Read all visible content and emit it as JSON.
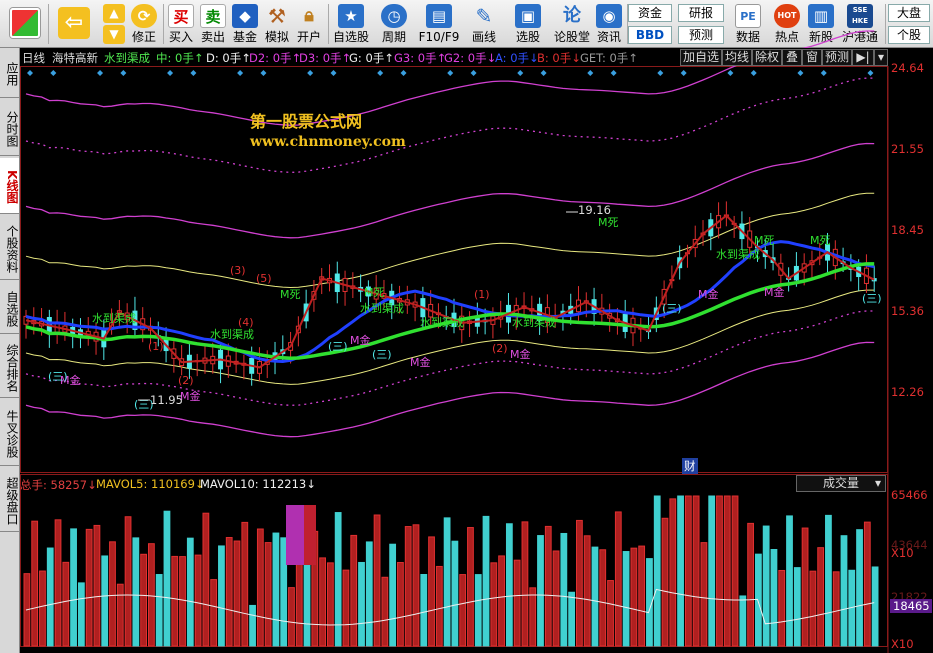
{
  "toolbar": {
    "buttons": [
      {
        "id": "windows",
        "label": "",
        "icon": "windows-logo-icon"
      },
      {
        "id": "back",
        "label": "",
        "icon": "back-arrow-icon"
      },
      {
        "id": "updown",
        "label": "",
        "icon": "up-down-arrows-icon"
      },
      {
        "id": "fix",
        "label": "修正",
        "icon": "restore-icon"
      },
      {
        "id": "buy",
        "label": "买入",
        "icon": "buy-icon",
        "glyph": "买"
      },
      {
        "id": "sell",
        "label": "卖出",
        "icon": "sell-icon",
        "glyph": "卖"
      },
      {
        "id": "fund",
        "label": "基金",
        "icon": "fund-icon"
      },
      {
        "id": "sim",
        "label": "模拟",
        "icon": "gavel-icon"
      },
      {
        "id": "open",
        "label": "开户",
        "icon": "lock-icon"
      },
      {
        "id": "watchlist",
        "label": "自选股",
        "icon": "star-icon"
      },
      {
        "id": "period",
        "label": "周期",
        "icon": "clock-icon"
      },
      {
        "id": "f10",
        "label": "F10/F9",
        "icon": "f10-icon"
      },
      {
        "id": "draw",
        "label": "画线",
        "icon": "pen-icon"
      },
      {
        "id": "pick",
        "label": "选股",
        "icon": "screen-icon"
      },
      {
        "id": "forum",
        "label": "论股堂",
        "icon": "forum-icon",
        "glyph": "论"
      },
      {
        "id": "news",
        "label": "资讯",
        "icon": "news-icon"
      },
      {
        "id": "data",
        "label": "数据",
        "icon": "pe-icon",
        "glyph": "PE"
      },
      {
        "id": "hot",
        "label": "热点",
        "icon": "hot-icon",
        "glyph": "HOT"
      },
      {
        "id": "newstock",
        "label": "新股",
        "icon": "new-stock-icon"
      },
      {
        "id": "hk",
        "label": "沪港通",
        "icon": "sse-hkex-icon",
        "glyph": "SSE HKE"
      }
    ],
    "boxes": {
      "capital": "资金",
      "bbd": "BBD",
      "research": "研报",
      "forecast": "预测",
      "market": "大盘",
      "stock": "个股"
    }
  },
  "sidetabs": [
    {
      "label": "应用",
      "active": false
    },
    {
      "label": "分时图",
      "active": false
    },
    {
      "label": "K线图",
      "active": true
    },
    {
      "label": "个股资料",
      "active": false
    },
    {
      "label": "自选股",
      "active": false
    },
    {
      "label": "综合排名",
      "active": false
    },
    {
      "label": "牛叉诊股",
      "active": false
    },
    {
      "label": "超级盘口",
      "active": false
    }
  ],
  "header": {
    "period": "日线",
    "stock": "海特高新",
    "indicator": "水到渠成",
    "items": [
      {
        "text": "中: 0手↑",
        "color": "#50e850"
      },
      {
        "text": "D: 0手↑",
        "color": "#f0f0f0"
      },
      {
        "text": "D2: 0手↑",
        "color": "#e040e0"
      },
      {
        "text": "D3: 0手↑",
        "color": "#e040e0"
      },
      {
        "text": "G: 0手↑",
        "color": "#f0f0f0"
      },
      {
        "text": "G3: 0手↑",
        "color": "#e040e0"
      },
      {
        "text": "G2: 0手↓",
        "color": "#e040e0"
      },
      {
        "text": "A: 0手↓",
        "color": "#3050ff"
      },
      {
        "text": "B: 0手↓",
        "color": "#e03030"
      },
      {
        "text": "GET: 0手↑",
        "color": "#999999"
      }
    ],
    "right_buttons": [
      "加自选",
      "均线",
      "除权",
      "叠",
      "窗",
      "预测",
      "▶|"
    ]
  },
  "watermark": {
    "title": "第一股票公式网",
    "url": "www.chnmoney.com"
  },
  "price_axis": [
    "24.64",
    "21.55",
    "18.45",
    "15.36",
    "12.26"
  ],
  "annotations": {
    "high": "19.16",
    "low": "11.95",
    "finance": "财",
    "labels": [
      "水到渠成",
      "M金",
      "M死",
      "(1)",
      "(2)",
      "(3)",
      "(4)",
      "(5)",
      "(三)"
    ]
  },
  "volume": {
    "total_label": "总手: 58257↓",
    "mavol5_label": "MAVOL5: 110169↓",
    "mavol10_label": "MAVOL10: 112213↓",
    "selector": "成交量",
    "axis": [
      "65466",
      "X10",
      "18465",
      "X10"
    ],
    "axis_faint": [
      "43644",
      "21822"
    ]
  },
  "colors": {
    "up": "#e03030",
    "down": "#50e8e8",
    "ma_green": "#30e030",
    "ma_blue": "#2040ff",
    "band_magenta": "#d040d0",
    "band_yellow": "#e8e880",
    "accent": "#f0c020"
  }
}
